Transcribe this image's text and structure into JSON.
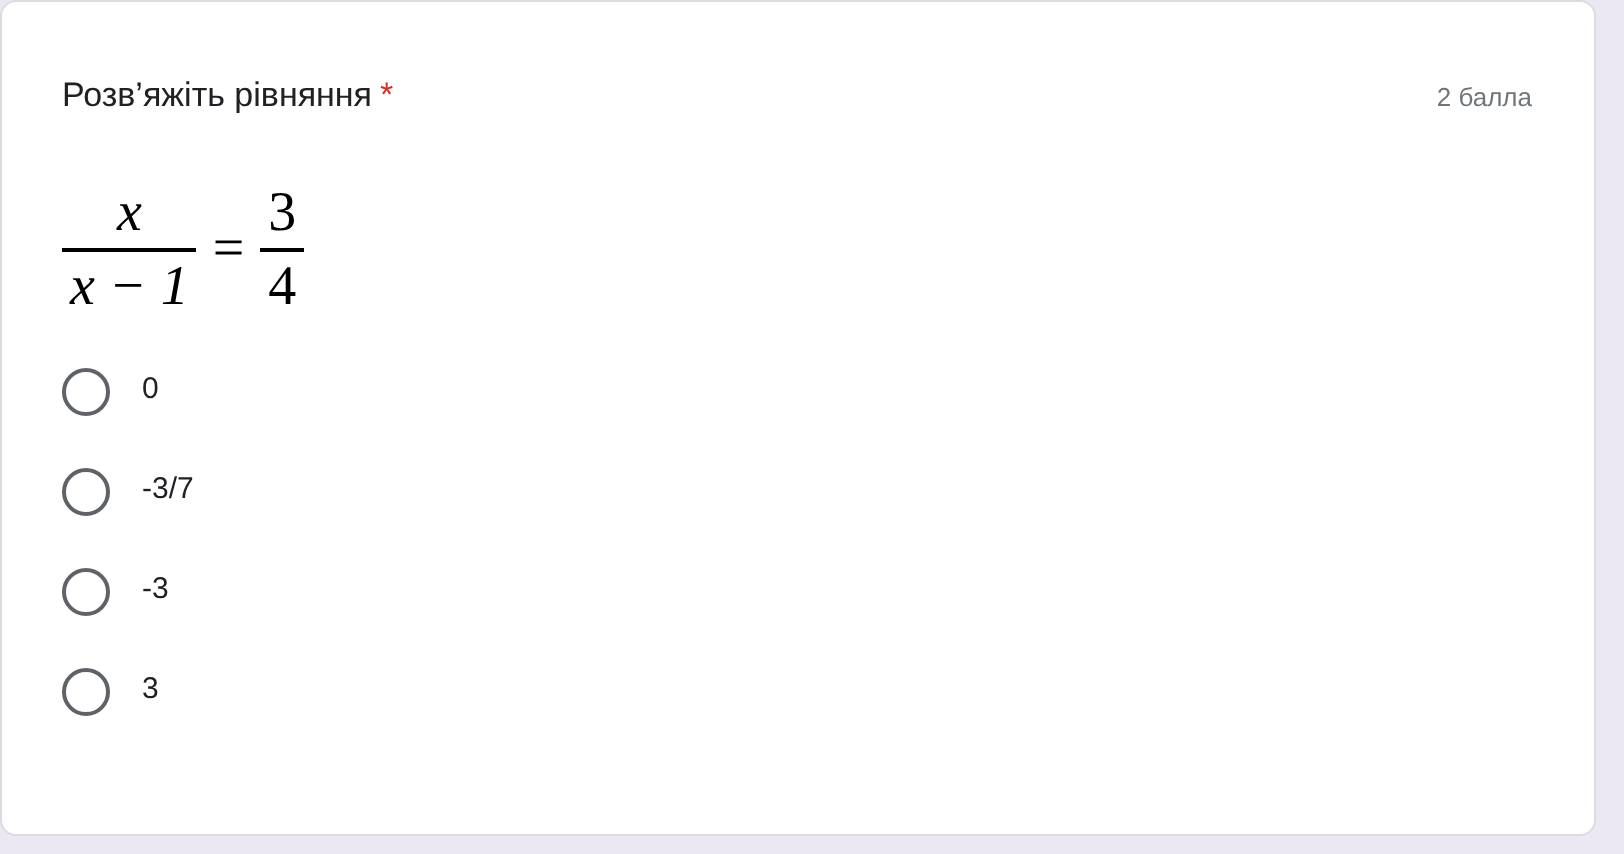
{
  "question": {
    "title": "Розв’яжіть рівняння",
    "required_mark": "*",
    "points": "2 балла"
  },
  "equation": {
    "left": {
      "numerator": "x",
      "denominator": "x − 1"
    },
    "sign": "=",
    "right": {
      "numerator": "3",
      "denominator": "4"
    }
  },
  "options": [
    {
      "label": "0",
      "selected": false
    },
    {
      "label": "-3/7",
      "selected": false
    },
    {
      "label": "-3",
      "selected": false
    },
    {
      "label": "3",
      "selected": false
    }
  ]
}
